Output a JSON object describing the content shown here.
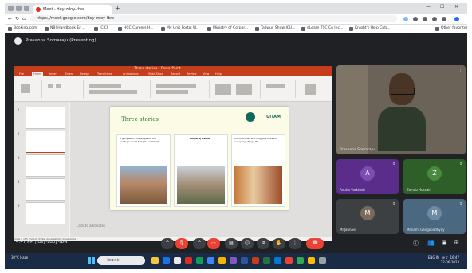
{
  "browser": {
    "tab_title": "Meet - dey-zdoy-tbw",
    "url": "https://meet.google.com/dey-zdoy-tbw",
    "bookmarks": [
      "Booking.com",
      "NBI Handbook Eri...",
      "ICICI",
      "HCC Careers H...",
      "My Unit Portal W...",
      "Ministry of Corpor...",
      "Tallwuv Show ICU...",
      "eLearn TSC Co Inc...",
      "Knight's Help Cntr...",
      "Other favorites"
    ]
  },
  "meet": {
    "presenter_label": "Prasanna Somaraju (Presenting)",
    "time": "4:47 PM",
    "meeting_code": "dey-zdoy-tbw",
    "participants": [
      {
        "name": "Prasanna Somaraju",
        "initial": "",
        "color": "#6b6358"
      },
      {
        "name": "Anuha Varkhedi",
        "initial": "A",
        "color": "#5b2d8a"
      },
      {
        "name": "Zeinab Hussain",
        "initial": "Z",
        "color": "#2f5f29"
      },
      {
        "name": "Ml Jahnavi",
        "initial": "M",
        "color": "#3c4043"
      },
      {
        "name": "Monami Gangopadhyay",
        "initial": "M",
        "color": "#4a6880"
      }
    ]
  },
  "ppt": {
    "window_title": "Three stories - PowerPoint",
    "tabs": [
      "File",
      "Home",
      "Insert",
      "Draw",
      "Design",
      "Transitions",
      "Animations",
      "Slide Show",
      "Record",
      "Review",
      "View",
      "Help"
    ],
    "slide": {
      "title": "Three stories",
      "logo_text": "GITAM",
      "cards": [
        {
          "heading": "A glimpse of shared pasts: the heritage of old temples and forts"
        },
        {
          "heading": "Lingaraj Gadda"
        },
        {
          "heading": "Communities and religious rituals in everyday village life"
        }
      ]
    },
    "notes_placeholder": "Click to add notes",
    "status": "Slide 2 of 5  English (India)  Accessibility: Investigate"
  },
  "taskbar": {
    "weather": "30°C Haze",
    "search_placeholder": "Search",
    "time": "16:47",
    "date": "22-06-2023",
    "lang": "ENG IN"
  }
}
